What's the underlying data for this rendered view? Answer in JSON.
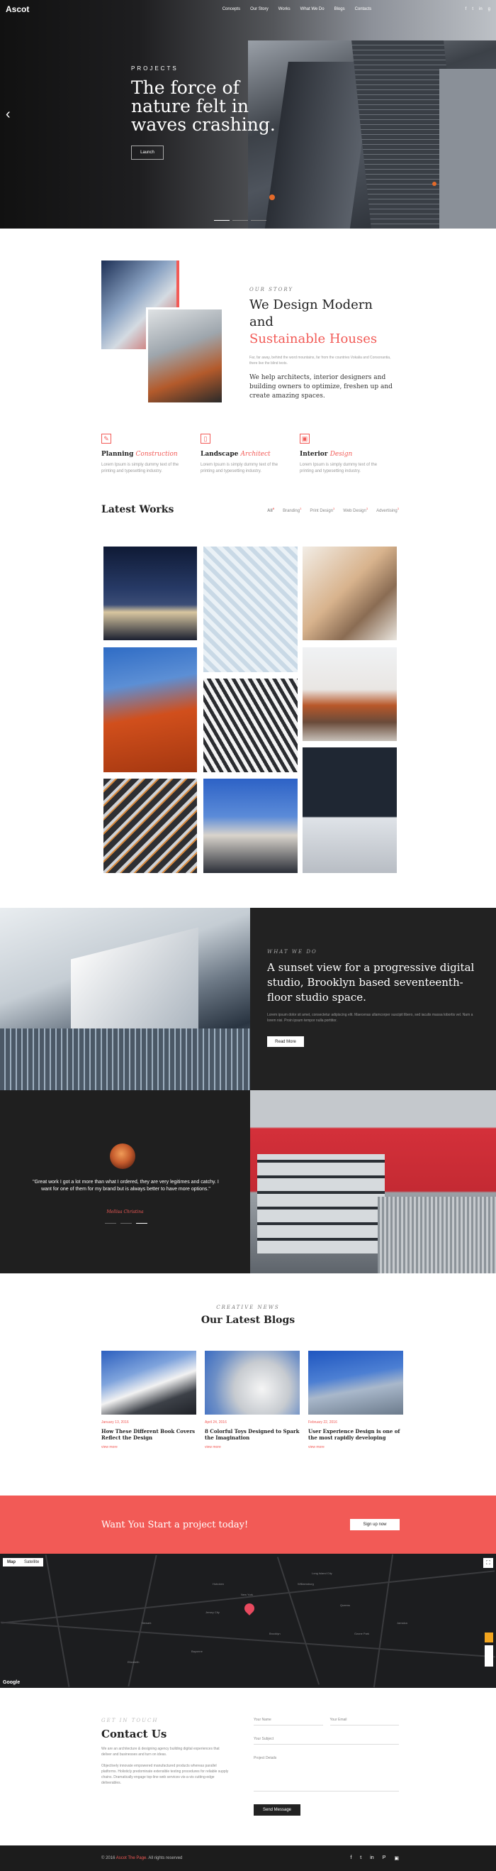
{
  "brand": {
    "logo": "Ascot"
  },
  "nav": {
    "items": [
      "Concepts",
      "Our Story",
      "Works",
      "What We Do",
      "Blogs",
      "Contacts"
    ]
  },
  "social_top": [
    "f",
    "t",
    "in",
    "g"
  ],
  "hero": {
    "kicker": "PROJECTS",
    "title": "The force of nature felt in waves crashing.",
    "button": "Launch",
    "arrow": "‹"
  },
  "story": {
    "kicker": "OUR STORY",
    "title_1": "We Design Modern and",
    "title_2": "Sustainable Houses",
    "small": "Far, far away, behind the word mountains, far from the countries Vokalia and Consonantia, there live the blind texts.",
    "lead": "We help architects, interior designers and building owners to optimize, freshen up and create amazing spaces."
  },
  "features": [
    {
      "icon": "✎",
      "title": "Planning",
      "accent": "Construction",
      "desc": "Lorem Ipsum is simply dummy text of the printing and typesetting industry."
    },
    {
      "icon": "▯",
      "title": "Landscape",
      "accent": "Architect",
      "desc": "Lorem Ipsum is simply dummy text of the printing and typesetting industry."
    },
    {
      "icon": "▣",
      "title": "Interior",
      "accent": "Design",
      "desc": "Lorem Ipsum is simply dummy text of the printing and typesetting industry."
    }
  ],
  "works": {
    "title": "Latest Works",
    "filters": [
      {
        "label": "All",
        "count": "9"
      },
      {
        "label": "Branding",
        "count": "3"
      },
      {
        "label": "Print Design",
        "count": "3"
      },
      {
        "label": "Web Design",
        "count": "3"
      },
      {
        "label": "Advertising",
        "count": "3"
      }
    ]
  },
  "what_we_do": {
    "kicker": "WHAT WE DO",
    "title": "A sunset view for a progressive digital studio, Brooklyn based seventeenth-floor studio space.",
    "desc": "Lorem ipsum dolor sit amet, consectetur adipiscing elit. Maecenas ullamcorper suscipit libero, sed iaculis massa lobortis vel. Nam a lorem nisi. Proin ipsum tempor nulla porttitor.",
    "button": "Read More"
  },
  "testimonial": {
    "quote": "\"Great work I got a lot more than what I ordered, they are very legitimes and catchy. I want for one of them for my brand but is always better to have more options.\"",
    "author": "Mellisa Christina"
  },
  "blogs": {
    "kicker": "CREATIVE NEWS",
    "title": "Our Latest Blogs",
    "posts": [
      {
        "date": "January 13, 2016",
        "title": "How These Different Book Covers Reflect the Design",
        "more": "view more"
      },
      {
        "date": "April 24, 2016",
        "title": "8 Colorful Toys Designed to Spark the Imagination",
        "more": "view more"
      },
      {
        "date": "February 22, 2016",
        "title": "User Experience Design is one of the most rapidly developing",
        "more": "view more"
      }
    ]
  },
  "cta": {
    "title": "Want You Start a project today!",
    "button": "Sign up now"
  },
  "map": {
    "tabs": [
      "Map",
      "Satellite"
    ],
    "fullscreen": "⛶",
    "google": "Google",
    "labels": [
      "New York",
      "Hoboken",
      "Brooklyn",
      "Queens",
      "Jersey City",
      "Bayonne",
      "Williamsburg",
      "Long Island City",
      "Ozone Park",
      "Jamaica",
      "Newark",
      "Elizabeth"
    ]
  },
  "contact": {
    "kicker": "GET IN TOUCH",
    "title": "Contact Us",
    "text_1": "We are an architecture & designing agency building digital experiences that deliver and businesses and turn on ideas.",
    "text_2": "Objectively innovate empowered manufactured products whereas parallel platforms. Holisticly predominate extensible testing procedures for reliable supply chains. Dramatically engage top-line web services vis-a-vis cutting-edge deliverables.",
    "name_placeholder": "Your Name",
    "email_placeholder": "Your Email",
    "subject_placeholder": "Your Subject",
    "message_placeholder": "Project Details",
    "button": "Send Message"
  },
  "footer": {
    "copy_prefix": "© 2016",
    "copy_brand": "Ascot The Page.",
    "copy_suffix": "All rights reserved",
    "social": [
      "f",
      "t",
      "in",
      "P",
      "▣"
    ]
  },
  "colors": {
    "accent": "#f25a56",
    "dark": "#222222"
  }
}
